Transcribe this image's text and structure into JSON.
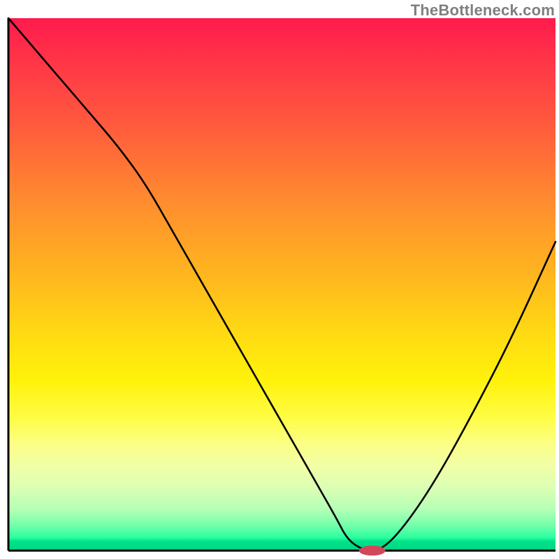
{
  "branding": {
    "watermark": "TheBottleneck.com"
  },
  "chart_data": {
    "type": "line",
    "title": "",
    "xlabel": "",
    "ylabel": "",
    "xlim": [
      0,
      100
    ],
    "ylim": [
      0,
      100
    ],
    "x": [
      0,
      5,
      10,
      15,
      20,
      25,
      30,
      35,
      40,
      45,
      50,
      55,
      60,
      62,
      65,
      68,
      72,
      78,
      85,
      92,
      100
    ],
    "values": [
      100,
      94,
      88,
      82,
      76,
      69,
      60,
      51,
      42,
      33,
      24,
      15,
      6,
      2,
      0,
      0,
      4,
      13,
      26,
      40,
      58
    ],
    "marker": {
      "x": 66.5,
      "y": 0,
      "rx": 2.4,
      "ry": 0.9,
      "color": "#d2475a"
    },
    "gradient_stops": [
      {
        "pct": 0,
        "color": "#ff1a4d"
      },
      {
        "pct": 50,
        "color": "#ffd500"
      },
      {
        "pct": 75,
        "color": "#fff85a"
      },
      {
        "pct": 95,
        "color": "#7affac"
      },
      {
        "pct": 100,
        "color": "#00d584"
      }
    ]
  }
}
